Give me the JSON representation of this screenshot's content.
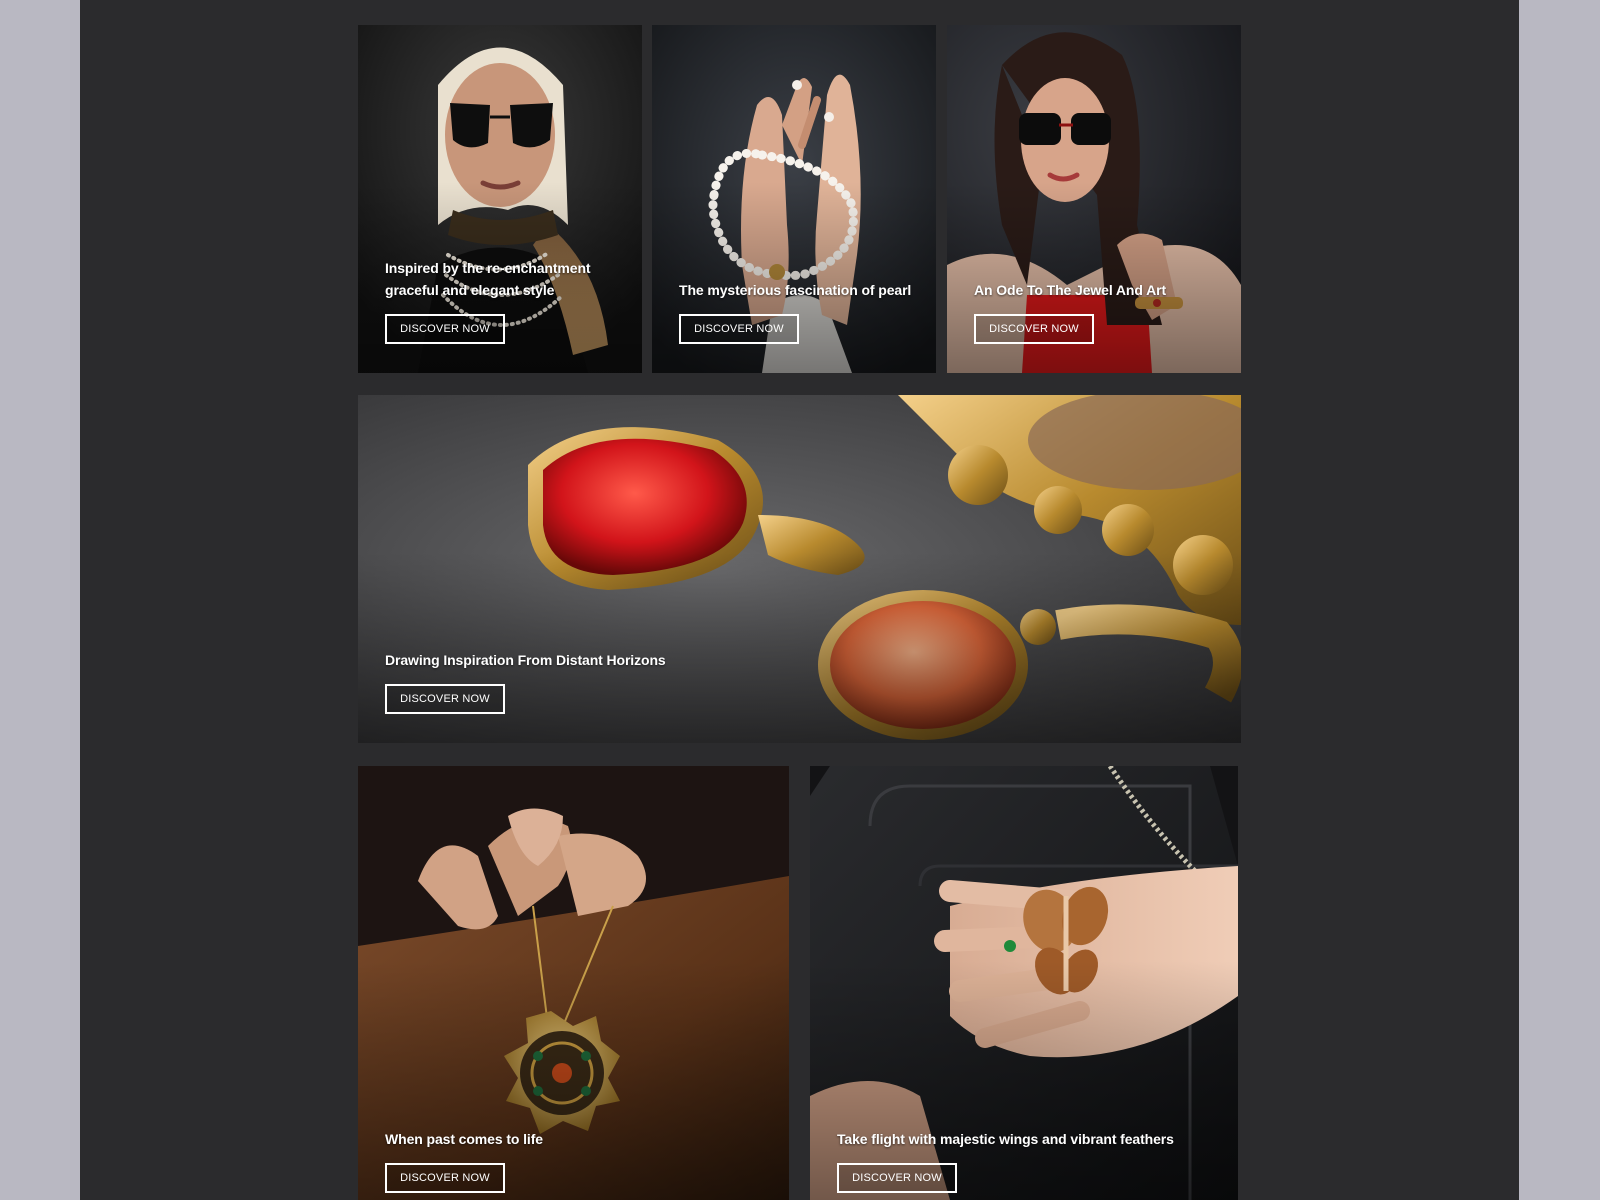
{
  "tiles": [
    {
      "caption_line1": "Inspired by the re-enchantment",
      "caption_line2": "graceful and elegant style",
      "button": "DISCOVER NOW"
    },
    {
      "caption_line1": "The mysterious fascination of pearl",
      "button": "DISCOVER NOW"
    },
    {
      "caption_line1": "An Ode To The Jewel And Art",
      "button": "DISCOVER NOW"
    },
    {
      "caption_line1": "Drawing Inspiration From Distant Horizons",
      "button": "DISCOVER NOW"
    },
    {
      "caption_line1": "When past comes to life",
      "button": "DISCOVER NOW"
    },
    {
      "caption_line1": "Take flight with majestic wings and vibrant feathers",
      "button": "DISCOVER NOW"
    }
  ],
  "colors": {
    "page_frame": "#2b2b2d",
    "outer_background": "#b9b8c2",
    "text": "#ffffff"
  }
}
